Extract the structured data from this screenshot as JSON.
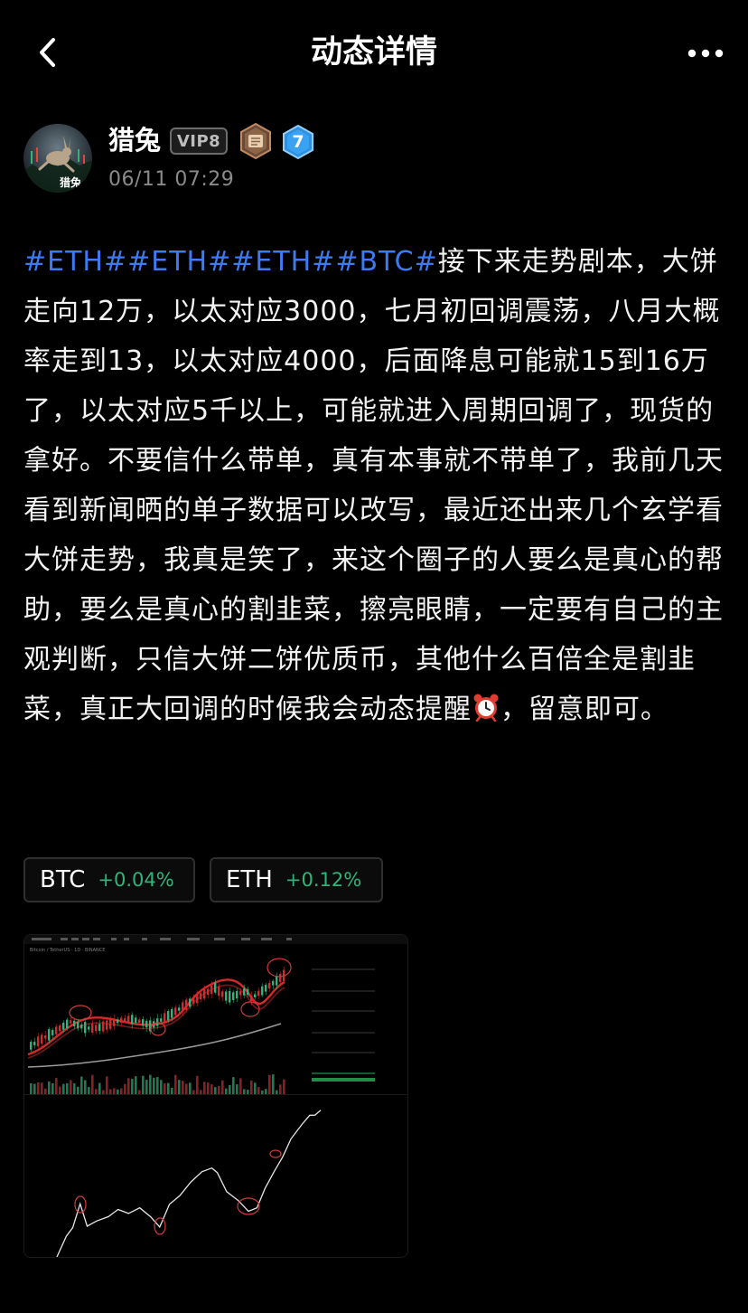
{
  "header": {
    "title": "动态详情",
    "back_icon": "chevron-left-icon",
    "more_icon": "more-horizontal-icon"
  },
  "author": {
    "name": "猎兔",
    "avatar_text": "猎兔",
    "vip_label": "VIP8",
    "level": "7",
    "time": "06/11 07:29"
  },
  "post": {
    "hashtags": [
      "#ETH#",
      "#ETH#",
      "#ETH#",
      "#BTC#"
    ],
    "text_part1": "接下来走势剧本，大饼走向12万，以太对应3000，七月初回调震荡，八月大概率走到13，以太对应4000，后面降息可能就15到16万了，以太对应5千以上，可能就进入周期回调了，现货的拿好。不要信什么带单，真有本事就不带单了，我前几天看到新闻晒的单子数据可以改写，最近还出来几个玄学看大饼走势，我真是笑了，来这个圈子的人要么是真心的帮助，要么是真心的割韭菜，擦亮眼睛，一定要有自己的主观判断，只信大饼二饼优质币，其他什么百倍全是割韭菜，真正大回调的时候我会动态提醒",
    "emoji_icon": "alarm-clock-icon",
    "text_part2": "，留意即可。"
  },
  "coins": [
    {
      "symbol": "BTC",
      "change": "+0.04%"
    },
    {
      "symbol": "ETH",
      "change": "+0.12%"
    }
  ],
  "chart_image": {
    "pair_label": "Bitcoin / TetherUS · 1D · BINANCE"
  },
  "colors": {
    "background": "#000000",
    "hashtag": "#3d7bf2",
    "positive": "#2fb57a",
    "muted": "#8a8a8a"
  }
}
